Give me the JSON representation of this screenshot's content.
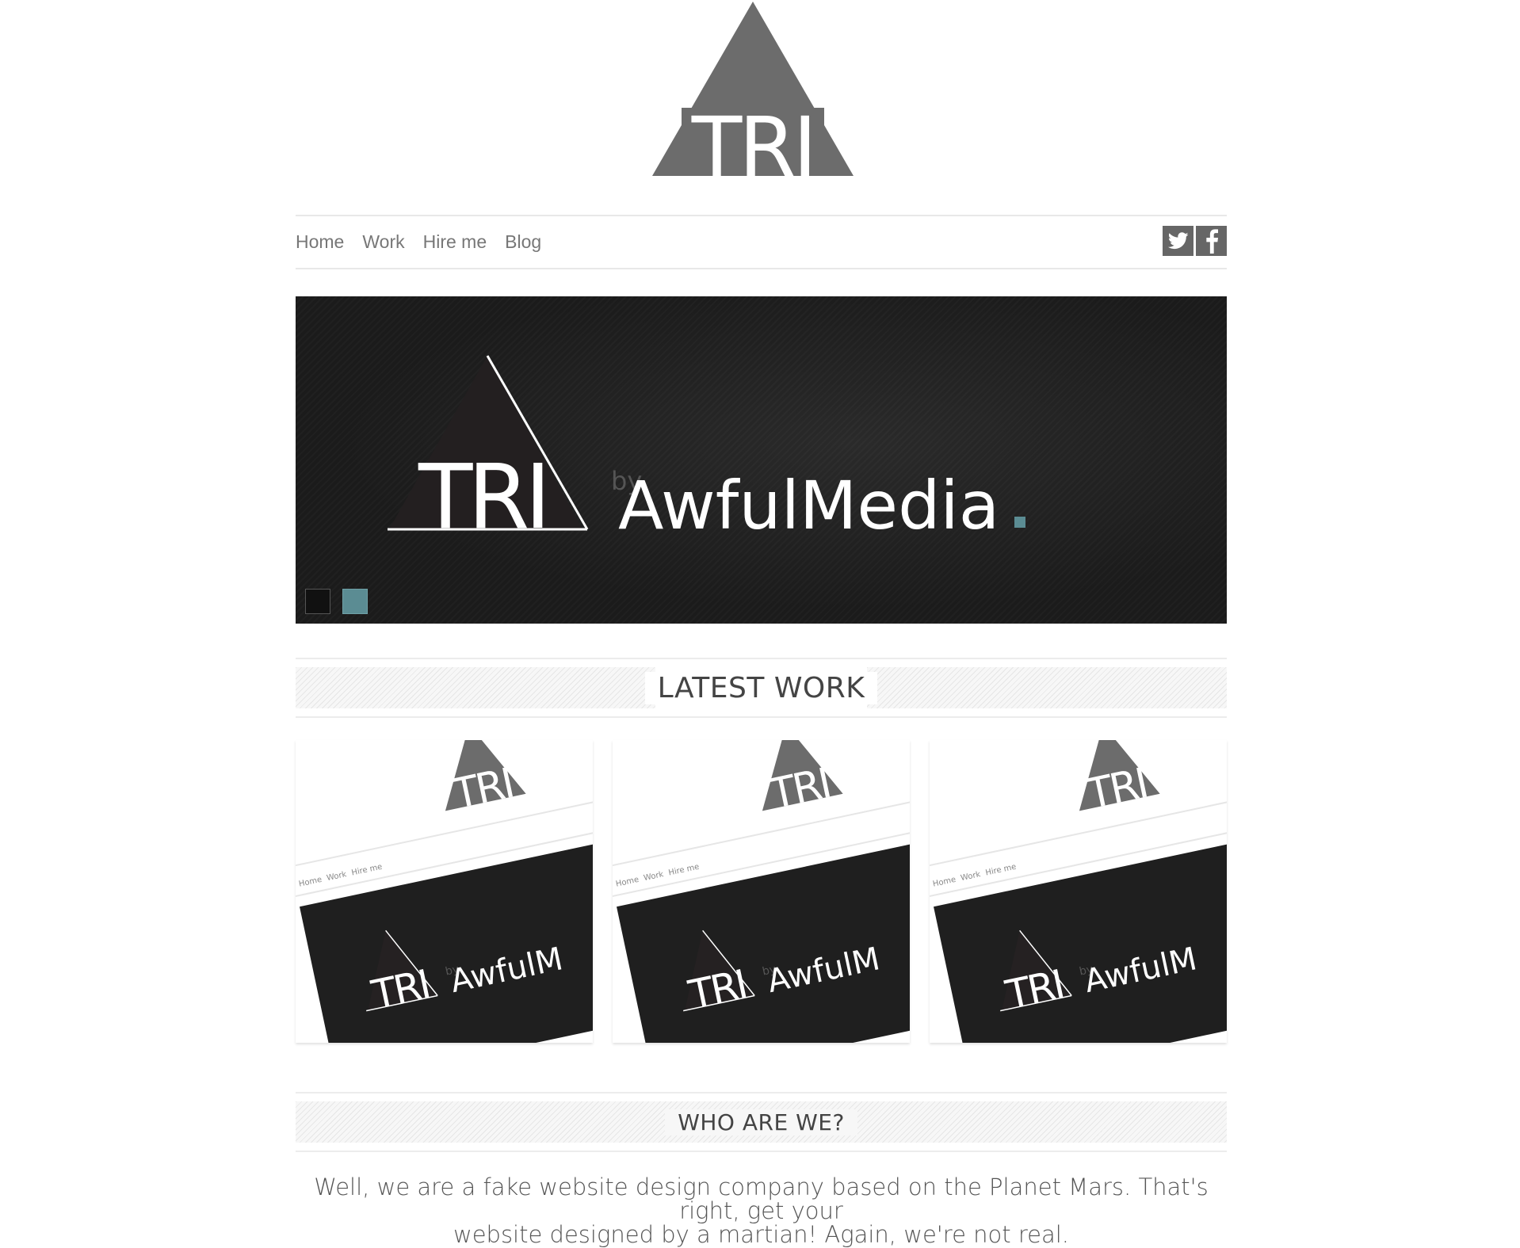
{
  "logo": {
    "text": "TRI",
    "alt": "TRI logo"
  },
  "nav": {
    "items": [
      "Home",
      "Work",
      "Hire me",
      "Blog"
    ]
  },
  "social": {
    "twitter_icon": "twitter-icon",
    "facebook_icon": "facebook-icon"
  },
  "hero": {
    "logo_text": "TRI",
    "by_text": "by",
    "brand_text": "AwfulMedia",
    "brand_dot": ".",
    "accent_color": "#5b8c93",
    "background_color": "#1b1b1b"
  },
  "latest_work": {
    "title": "LATEST WORK",
    "cards": [
      {
        "nav": [
          "Home",
          "Work",
          "Hire me"
        ],
        "logo": "TRI",
        "by": "by",
        "brand": "AwfulM"
      },
      {
        "nav": [
          "Home",
          "Work",
          "Hire me"
        ],
        "logo": "TRI",
        "by": "by",
        "brand": "AwfulM"
      },
      {
        "nav": [
          "Home",
          "Work",
          "Hire me"
        ],
        "logo": "TRI",
        "by": "by",
        "brand": "AwfulM"
      }
    ]
  },
  "who": {
    "title": "WHO ARE WE?",
    "text_line1": "Well, we are a fake website design company based on the Planet Mars. That's right, get your",
    "text_line2": "website designed by a martian! Again, we're not real."
  }
}
